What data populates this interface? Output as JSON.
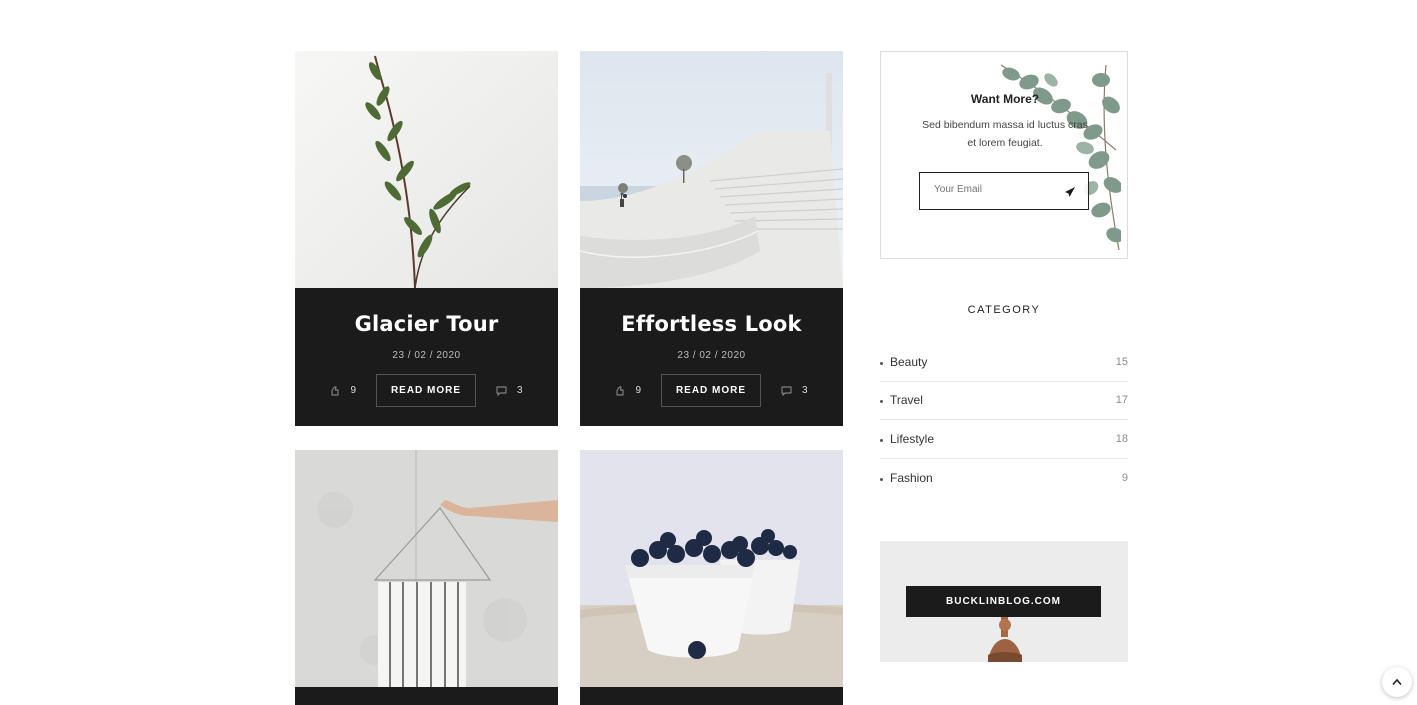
{
  "posts": [
    {
      "title": "Glacier Tour",
      "date": "23 / 02 / 2020",
      "likes": "9",
      "comments": "3",
      "read_more": "READ MORE"
    },
    {
      "title": "Effortless Look",
      "date": "23 / 02 / 2020",
      "likes": "9",
      "comments": "3",
      "read_more": "READ MORE"
    }
  ],
  "subscribe": {
    "title": "Want More?",
    "text": "Sed bibendum massa id luctus cras et lorem feugiat.",
    "email_placeholder": "Your Email"
  },
  "category": {
    "title": "CATEGORY",
    "items": [
      {
        "name": "Beauty",
        "count": "15"
      },
      {
        "name": "Travel",
        "count": "17"
      },
      {
        "name": "Lifestyle",
        "count": "18"
      },
      {
        "name": "Fashion",
        "count": "9"
      }
    ]
  },
  "banner": {
    "label": "BUCKLINBLOG.COM"
  },
  "colors": {
    "dark": "#1b1b1b",
    "text": "#222222",
    "muted": "#8b8b8b"
  },
  "icons": [
    "like-icon",
    "comment-icon",
    "send-icon",
    "arrow-up-icon"
  ]
}
